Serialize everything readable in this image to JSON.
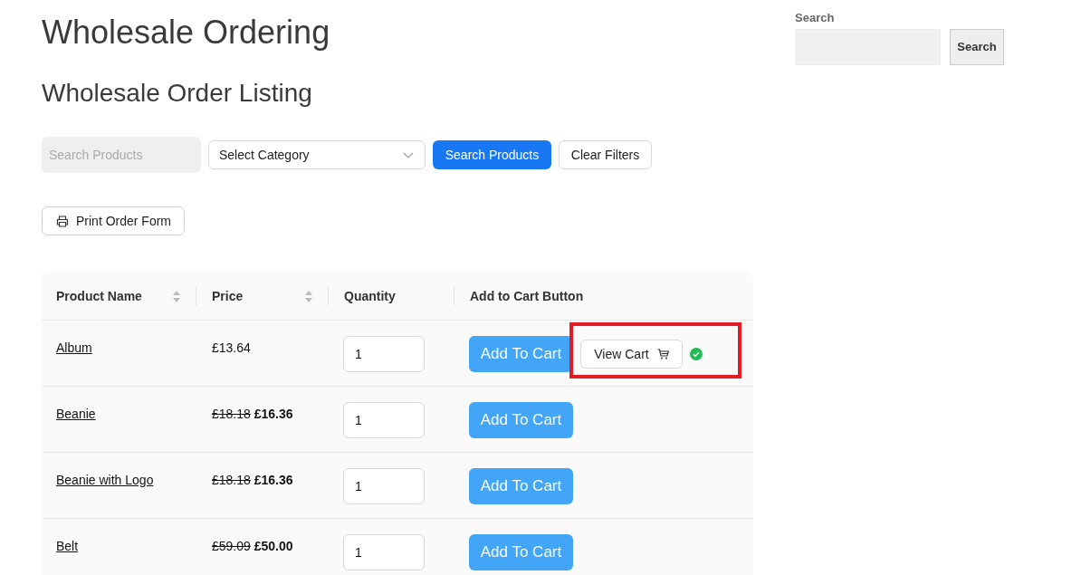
{
  "page": {
    "title": "Wholesale Ordering",
    "subtitle": "Wholesale Order Listing"
  },
  "filters": {
    "search": {
      "placeholder": "Search Products"
    },
    "category": {
      "value": "Select Category"
    },
    "search_button": "Search Products",
    "clear_button": "Clear Filters"
  },
  "print_button": "Print Order Form",
  "table": {
    "columns": [
      {
        "label": "Product Name",
        "sortable": true
      },
      {
        "label": "Price",
        "sortable": true
      },
      {
        "label": "Quantity",
        "sortable": false
      },
      {
        "label": "Add to Cart Button",
        "sortable": false
      }
    ],
    "rows": [
      {
        "name": "Album",
        "price": "£13.64",
        "on_sale": false,
        "quantity": "1",
        "button": "Add To Cart",
        "added": true,
        "view_cart": "View Cart",
        "highlighted": true
      },
      {
        "name": "Beanie",
        "price": "£18.18",
        "on_sale": true,
        "sale_price": "£16.36",
        "quantity": "1",
        "button": "Add To Cart",
        "added": false,
        "highlighted": false
      },
      {
        "name": "Beanie with Logo",
        "price": "£18.18",
        "on_sale": true,
        "sale_price": "£16.36",
        "quantity": "1",
        "button": "Add To Cart",
        "added": false,
        "highlighted": false
      },
      {
        "name": "Belt",
        "price": "£59.09",
        "on_sale": true,
        "sale_price": "£50.00",
        "quantity": "1",
        "button": "Add To Cart",
        "added": false,
        "highlighted": false
      }
    ]
  },
  "sidebar": {
    "search": {
      "label": "Search",
      "button": "Search"
    }
  }
}
